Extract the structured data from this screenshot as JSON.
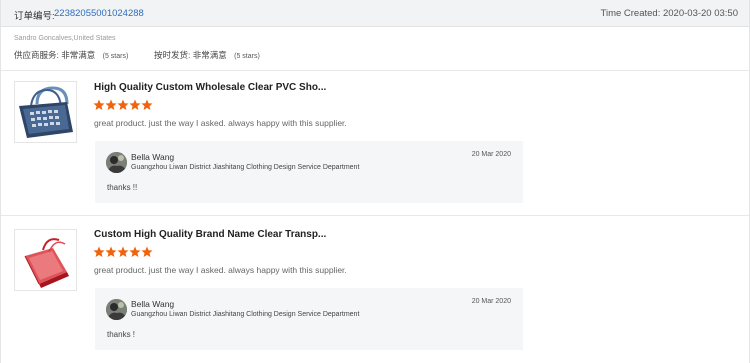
{
  "order": {
    "label": "订单编号:",
    "number": "22382055001024288",
    "time_created": "Time Created: 2020-03-20 03:50"
  },
  "buyer": {
    "name": "Sandro Goncalves,United States",
    "supplier_rating": {
      "label": "供应商服务:",
      "value": "非常满意",
      "stars_text": "(5 stars)",
      "stars": 5
    },
    "shipping_rating": {
      "label": "按时发货:",
      "value": "非常满意",
      "stars_text": "(5 stars)",
      "stars": 5
    }
  },
  "colors": {
    "star": "#f0640e",
    "link": "#2f6dbd"
  },
  "reviews": [
    {
      "product_title": "High Quality Custom Wholesale Clear PVC Sho...",
      "rating": 5,
      "text": "great product. just the way I asked. always happy with this supplier.",
      "thumbnail_icon": "tote-bag-image",
      "reply": {
        "name": "Bella Wang",
        "company": "Guangzhou Liwan District Jiashitang Clothing Design Service Department",
        "date": "20 Mar 2020",
        "text": "thanks !!"
      }
    },
    {
      "product_title": "Custom High Quality Brand Name Clear Transp...",
      "rating": 5,
      "text": "great product. just the way I asked. always happy with this supplier.",
      "thumbnail_icon": "red-gift-bag-image",
      "reply": {
        "name": "Bella Wang",
        "company": "Guangzhou Liwan District Jiashitang Clothing Design Service Department",
        "date": "20 Mar 2020",
        "text": "thanks !"
      }
    }
  ]
}
